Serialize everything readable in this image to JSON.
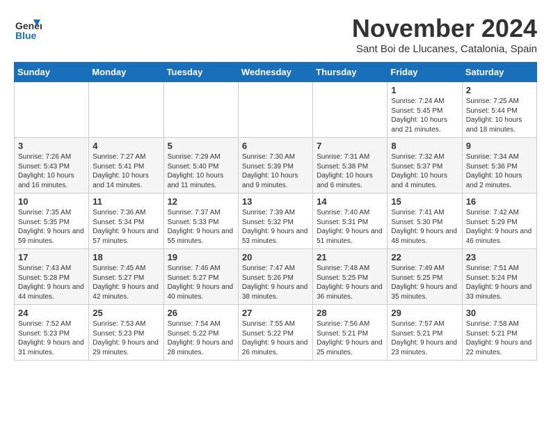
{
  "header": {
    "logo_line1": "General",
    "logo_line2": "Blue",
    "month_title": "November 2024",
    "location": "Sant Boi de Llucanes, Catalonia, Spain"
  },
  "weekdays": [
    "Sunday",
    "Monday",
    "Tuesday",
    "Wednesday",
    "Thursday",
    "Friday",
    "Saturday"
  ],
  "weeks": [
    [
      {
        "day": "",
        "detail": ""
      },
      {
        "day": "",
        "detail": ""
      },
      {
        "day": "",
        "detail": ""
      },
      {
        "day": "",
        "detail": ""
      },
      {
        "day": "",
        "detail": ""
      },
      {
        "day": "1",
        "detail": "Sunrise: 7:24 AM\nSunset: 5:45 PM\nDaylight: 10 hours\nand 21 minutes."
      },
      {
        "day": "2",
        "detail": "Sunrise: 7:25 AM\nSunset: 5:44 PM\nDaylight: 10 hours\nand 18 minutes."
      }
    ],
    [
      {
        "day": "3",
        "detail": "Sunrise: 7:26 AM\nSunset: 5:43 PM\nDaylight: 10 hours\nand 16 minutes."
      },
      {
        "day": "4",
        "detail": "Sunrise: 7:27 AM\nSunset: 5:41 PM\nDaylight: 10 hours\nand 14 minutes."
      },
      {
        "day": "5",
        "detail": "Sunrise: 7:29 AM\nSunset: 5:40 PM\nDaylight: 10 hours\nand 11 minutes."
      },
      {
        "day": "6",
        "detail": "Sunrise: 7:30 AM\nSunset: 5:39 PM\nDaylight: 10 hours\nand 9 minutes."
      },
      {
        "day": "7",
        "detail": "Sunrise: 7:31 AM\nSunset: 5:38 PM\nDaylight: 10 hours\nand 6 minutes."
      },
      {
        "day": "8",
        "detail": "Sunrise: 7:32 AM\nSunset: 5:37 PM\nDaylight: 10 hours\nand 4 minutes."
      },
      {
        "day": "9",
        "detail": "Sunrise: 7:34 AM\nSunset: 5:36 PM\nDaylight: 10 hours\nand 2 minutes."
      }
    ],
    [
      {
        "day": "10",
        "detail": "Sunrise: 7:35 AM\nSunset: 5:35 PM\nDaylight: 9 hours\nand 59 minutes."
      },
      {
        "day": "11",
        "detail": "Sunrise: 7:36 AM\nSunset: 5:34 PM\nDaylight: 9 hours\nand 57 minutes."
      },
      {
        "day": "12",
        "detail": "Sunrise: 7:37 AM\nSunset: 5:33 PM\nDaylight: 9 hours\nand 55 minutes."
      },
      {
        "day": "13",
        "detail": "Sunrise: 7:39 AM\nSunset: 5:32 PM\nDaylight: 9 hours\nand 53 minutes."
      },
      {
        "day": "14",
        "detail": "Sunrise: 7:40 AM\nSunset: 5:31 PM\nDaylight: 9 hours\nand 51 minutes."
      },
      {
        "day": "15",
        "detail": "Sunrise: 7:41 AM\nSunset: 5:30 PM\nDaylight: 9 hours\nand 48 minutes."
      },
      {
        "day": "16",
        "detail": "Sunrise: 7:42 AM\nSunset: 5:29 PM\nDaylight: 9 hours\nand 46 minutes."
      }
    ],
    [
      {
        "day": "17",
        "detail": "Sunrise: 7:43 AM\nSunset: 5:28 PM\nDaylight: 9 hours\nand 44 minutes."
      },
      {
        "day": "18",
        "detail": "Sunrise: 7:45 AM\nSunset: 5:27 PM\nDaylight: 9 hours\nand 42 minutes."
      },
      {
        "day": "19",
        "detail": "Sunrise: 7:46 AM\nSunset: 5:27 PM\nDaylight: 9 hours\nand 40 minutes."
      },
      {
        "day": "20",
        "detail": "Sunrise: 7:47 AM\nSunset: 5:26 PM\nDaylight: 9 hours\nand 38 minutes."
      },
      {
        "day": "21",
        "detail": "Sunrise: 7:48 AM\nSunset: 5:25 PM\nDaylight: 9 hours\nand 36 minutes."
      },
      {
        "day": "22",
        "detail": "Sunrise: 7:49 AM\nSunset: 5:25 PM\nDaylight: 9 hours\nand 35 minutes."
      },
      {
        "day": "23",
        "detail": "Sunrise: 7:51 AM\nSunset: 5:24 PM\nDaylight: 9 hours\nand 33 minutes."
      }
    ],
    [
      {
        "day": "24",
        "detail": "Sunrise: 7:52 AM\nSunset: 5:23 PM\nDaylight: 9 hours\nand 31 minutes."
      },
      {
        "day": "25",
        "detail": "Sunrise: 7:53 AM\nSunset: 5:23 PM\nDaylight: 9 hours\nand 29 minutes."
      },
      {
        "day": "26",
        "detail": "Sunrise: 7:54 AM\nSunset: 5:22 PM\nDaylight: 9 hours\nand 28 minutes."
      },
      {
        "day": "27",
        "detail": "Sunrise: 7:55 AM\nSunset: 5:22 PM\nDaylight: 9 hours\nand 26 minutes."
      },
      {
        "day": "28",
        "detail": "Sunrise: 7:56 AM\nSunset: 5:21 PM\nDaylight: 9 hours\nand 25 minutes."
      },
      {
        "day": "29",
        "detail": "Sunrise: 7:57 AM\nSunset: 5:21 PM\nDaylight: 9 hours\nand 23 minutes."
      },
      {
        "day": "30",
        "detail": "Sunrise: 7:58 AM\nSunset: 5:21 PM\nDaylight: 9 hours\nand 22 minutes."
      }
    ]
  ]
}
